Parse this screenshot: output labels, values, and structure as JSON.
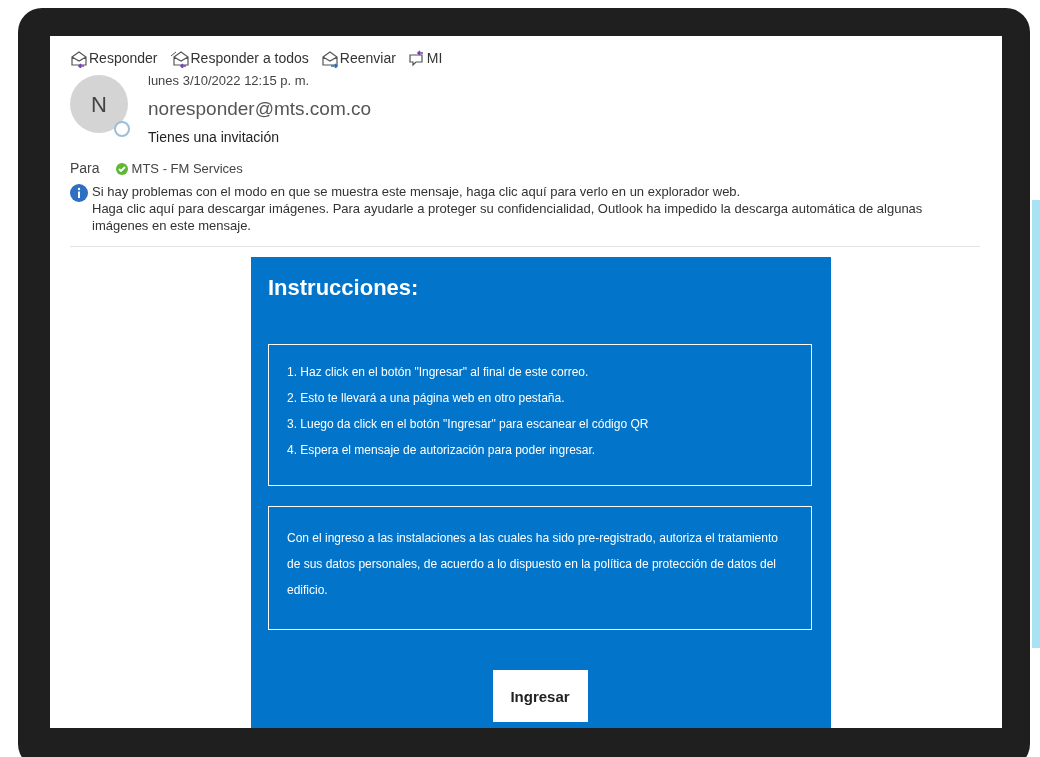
{
  "toolbar": [
    {
      "kind": "reply",
      "label": "Responder"
    },
    {
      "kind": "reply_all",
      "label": "Responder a todos"
    },
    {
      "kind": "forward",
      "label": "Reenviar"
    },
    {
      "kind": "im",
      "label": "MI"
    }
  ],
  "message": {
    "avatar_initial": "N",
    "date": "lunes 3/10/2022 12:15 p. m.",
    "sender": "noresponder@mts.com.co",
    "subject": "Tienes una invitación",
    "to_label": "Para",
    "recipient": "MTS - FM Services",
    "recipient_online": true,
    "info_lines": [
      "Si hay problemas con el modo en que se muestra este mensaje, haga clic aquí para verlo en un explorador web.",
      "Haga clic aquí para descargar imágenes. Para ayudarle a proteger su confidencialidad, Outlook ha impedido la descarga automática de algunas imágenes en este mensaje."
    ]
  },
  "body": {
    "title": "Instrucciones:",
    "steps": [
      "1. Haz click en el botón \"Ingresar\" al final de este correo.",
      "2. Esto te llevará a una página web en otro pestaña.",
      "3. Luego da click en el botón \"Ingresar\" para escanear el código QR",
      "4. Espera el mensaje de autorización para poder ingresar."
    ],
    "consent": "Con el ingreso a las instalaciones a las cuales ha sido pre-registrado, autoriza el tratamiento de sus datos personales, de acuerdo a lo dispuesto en la política de protección de datos del edificio.",
    "button": "Ingresar"
  }
}
